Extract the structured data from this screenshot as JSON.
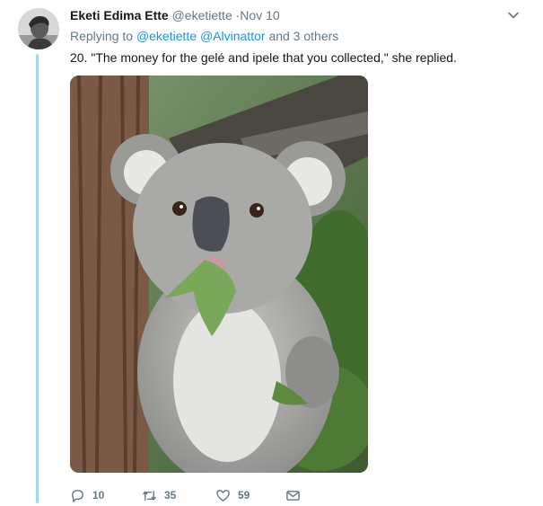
{
  "tweet": {
    "author_name": "Eketi Edima Ette",
    "author_handle": "@eketiette",
    "separator": "·",
    "date": "Nov 10",
    "replying_prefix": "Replying to",
    "mention_1": "@eketiette",
    "mention_2": "@Alvinattor",
    "others": "and 3 others",
    "text": "20. \"The money for the gelé and ipele that you collected,\" she replied."
  },
  "actions": {
    "reply_count": "10",
    "retweet_count": "35",
    "like_count": "59"
  },
  "icons": {
    "caret": "chevron-down-icon",
    "reply": "reply-icon",
    "retweet": "retweet-icon",
    "like": "heart-icon",
    "dm": "envelope-icon"
  },
  "colors": {
    "link": "#1b95e0",
    "muted": "#657786",
    "thread_line": "#a8d6ef"
  }
}
